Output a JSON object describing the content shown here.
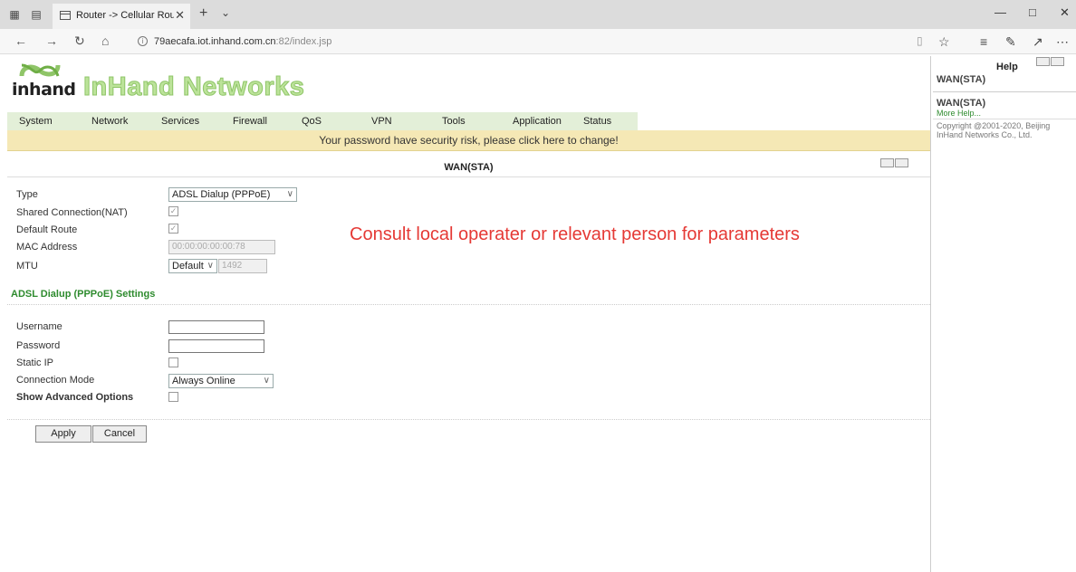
{
  "browser": {
    "tab_title": "Router -> Cellular Route",
    "url_host": "79aecafa.iot.inhand.com.cn",
    "url_path": ":82/index.jsp"
  },
  "brand": {
    "small": "inhand",
    "big": "InHand Networks",
    "colors": {
      "primary": "#bce39a",
      "menu_bg": "#e3efd8",
      "warn_bg": "#f5e8b5",
      "note": "#e53935",
      "section": "#2e8b2e"
    }
  },
  "menu": [
    "System",
    "Network",
    "Services",
    "Firewall",
    "QoS",
    "VPN",
    "Tools",
    "Application",
    "Status"
  ],
  "warning": "Your password have security risk, please click here to change!",
  "section_title": "WAN(STA)",
  "form": {
    "type_label": "Type",
    "type_value": "ADSL Dialup (PPPoE)",
    "nat_label": "Shared Connection(NAT)",
    "nat_checked": true,
    "default_route_label": "Default Route",
    "default_route_checked": true,
    "mac_label": "MAC Address",
    "mac_value": "00:00:00:00:00:78",
    "mtu_label": "MTU",
    "mtu_mode": "Default",
    "mtu_value": "1492"
  },
  "note": "Consult local operater or relevant person for parameters",
  "pppoe": {
    "title": "ADSL Dialup (PPPoE) Settings",
    "username_label": "Username",
    "username_value": "",
    "password_label": "Password",
    "password_value": "",
    "static_ip_label": "Static IP",
    "static_ip_checked": false,
    "connection_mode_label": "Connection Mode",
    "connection_mode_value": "Always Online",
    "advanced_label": "Show Advanced Options",
    "advanced_checked": false
  },
  "buttons": {
    "apply": "Apply",
    "cancel": "Cancel"
  },
  "help": {
    "title": "Help",
    "heading1": "WAN(STA)",
    "heading2": "WAN(STA)",
    "more": "More Help...",
    "copyright": "Copyright @2001-2020, Beijing InHand Networks Co., Ltd."
  }
}
